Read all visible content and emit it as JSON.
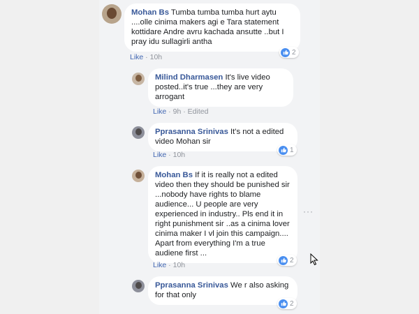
{
  "comments": [
    {
      "author": "Mohan Bs",
      "text": "Tumba tumba tumba hurt aytu ....olle cinima makers agi e Tara statement kottidare Andre avru kachada ansutte ..but I pray idu sullagirli antha",
      "like_label": "Like",
      "time": "10h",
      "reactions": "2",
      "avatar_icon": "profile-photo"
    },
    {
      "author": "Milind Dharmasen",
      "text": "It's live video posted..it's true ...they are very arrogant",
      "like_label": "Like",
      "time": "9h",
      "edited_label": "Edited",
      "avatar_icon": "profile-photo"
    },
    {
      "author": "Pprasanna Srinivas",
      "text": "It's not a edited video Mohan sir",
      "like_label": "Like",
      "time": "10h",
      "reactions": "1",
      "avatar_icon": "profile-photo"
    },
    {
      "author": "Mohan Bs",
      "text": "If it is really not a edited video then they should be punished sir ...nobody have rights to blame audience... U people are very experienced in industry.. Pls end it in right punishment sir ..as a cinima lover cinima maker I vl join this campaign.... Apart from everything I'm a true audiene first ...",
      "like_label": "Like",
      "time": "10h",
      "reactions": "2",
      "avatar_icon": "profile-photo"
    },
    {
      "author": "Pprasanna Srinivas",
      "text": "We r also asking for that only",
      "reactions": "2",
      "avatar_icon": "profile-photo"
    }
  ],
  "separator": " · ",
  "more_options": "···",
  "colors": {
    "author": "#385898",
    "like_link": "#4267b2",
    "meta": "#90949c",
    "reaction_thumb": "#4a8ff0",
    "feed_bg": "#f2f3f5",
    "bubble_bg": "#ffffff"
  }
}
